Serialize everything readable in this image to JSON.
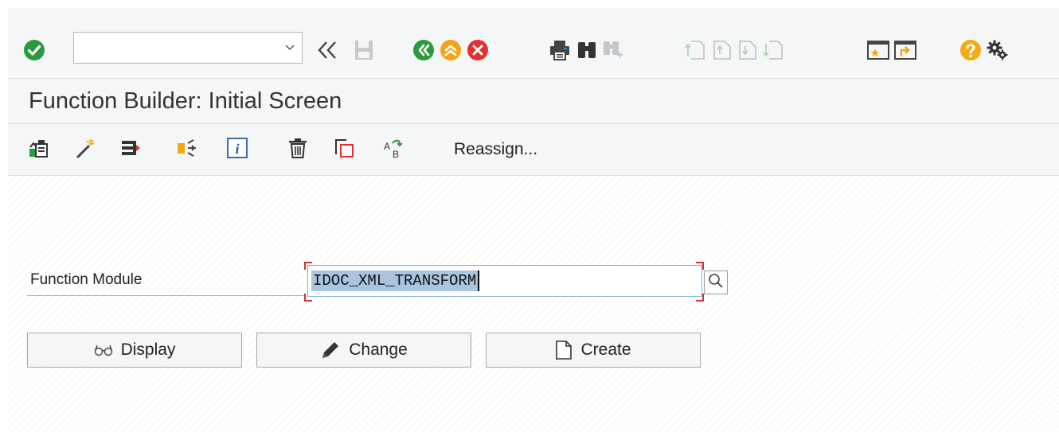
{
  "system_toolbar": {
    "command_field": {
      "value": "",
      "placeholder": ""
    },
    "icons": [
      "enter-icon",
      "back-double-arrow-icon",
      "save-icon",
      "back-icon",
      "exit-icon",
      "cancel-icon",
      "print-icon",
      "find-icon",
      "find-next-icon",
      "first-page-icon",
      "previous-page-icon",
      "next-page-icon",
      "last-page-icon",
      "create-session-icon",
      "generate-shortcut-icon",
      "help-icon",
      "customize-layout-icon"
    ]
  },
  "title_bar": {
    "title": "Function Builder: Initial Screen"
  },
  "app_toolbar": {
    "icons": [
      "other-object-icon",
      "wizard-icon",
      "where-used-icon",
      "test-icon",
      "info-icon",
      "delete-icon",
      "copy-icon",
      "rename-icon"
    ],
    "reassign_label": "Reassign..."
  },
  "form": {
    "function_module_label": "Function Module",
    "function_module_value": "IDOC_XML_TRANSFORM"
  },
  "buttons": {
    "display_label": "Display",
    "change_label": "Change",
    "create_label": "Create"
  },
  "colors": {
    "enter_green": "#2b9a3e",
    "back_green": "#2b9a3e",
    "exit_orange": "#f2a516",
    "cancel_red": "#e4312f",
    "help_orange": "#f0ab1a",
    "selection_blue": "#a9c5e0",
    "required_red": "#d9302b"
  }
}
